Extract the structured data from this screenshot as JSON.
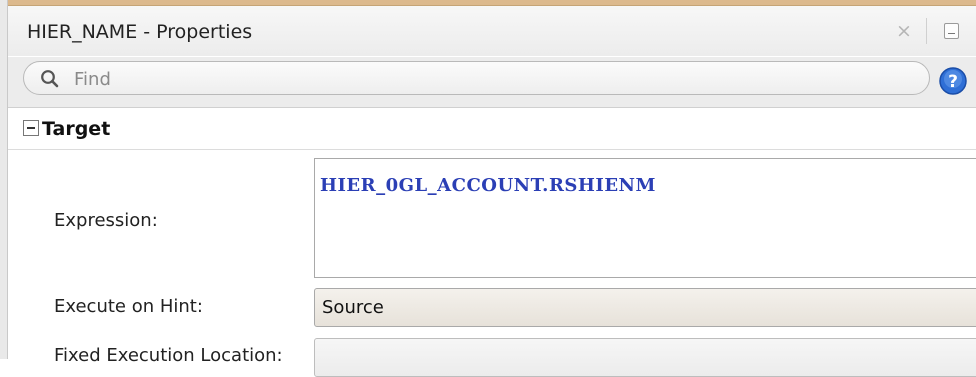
{
  "window": {
    "title": "HIER_NAME - Properties",
    "close_symbol": "×",
    "minimize_icon": "minimize-icon"
  },
  "search": {
    "placeholder": "Find",
    "icon": "search-icon",
    "help_icon": "help-icon"
  },
  "section": {
    "title": "Target",
    "collapse_icon": "collapse-icon"
  },
  "form": {
    "expression_label": "Expression:",
    "expression_value": "HIER_0GL_ACCOUNT.RSHIENM",
    "execute_hint_label": "Execute on Hint:",
    "execute_hint_value": "Source",
    "fixed_location_label": "Fixed Execution Location:"
  },
  "colors": {
    "accent": "#dcb98d",
    "expression_text": "#2b3fb5",
    "help_blue": "#2f6fd6"
  }
}
